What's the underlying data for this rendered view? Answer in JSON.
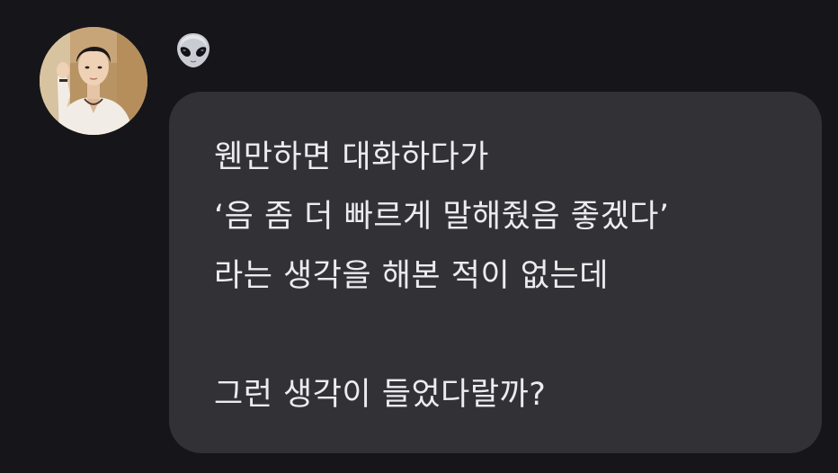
{
  "sender": {
    "avatar_icon": "profile-photo",
    "name_icon": "alien-face-icon",
    "name_glyph": "👽"
  },
  "message": {
    "lines": [
      "웬만하면 대화하다가",
      "‘음 좀 더 빠르게 말해줬음 좋겠다’",
      "라는 생각을 해본 적이 없는데",
      "",
      "그런 생각이 들었다랄까?"
    ]
  },
  "colors": {
    "background": "#16161a",
    "bubble": "#323236",
    "text": "#ececee"
  }
}
